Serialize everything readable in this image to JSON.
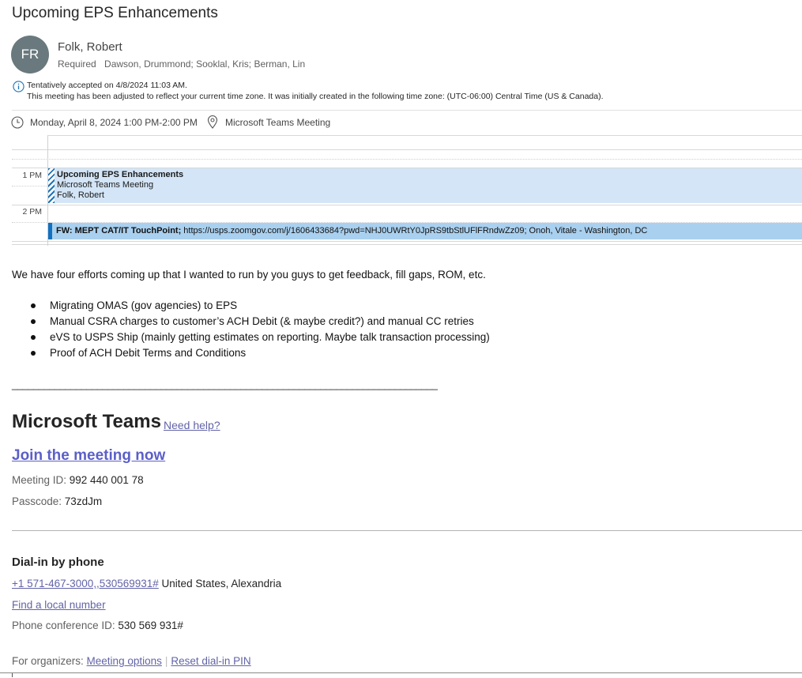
{
  "subject": "Upcoming EPS Enhancements",
  "organizer": {
    "initials": "FR",
    "name": "Folk, Robert",
    "avatar_color": "#69797e"
  },
  "attendees": {
    "label": "Required",
    "names": "Dawson, Drummond; Sooklal, Kris; Berman, Lin"
  },
  "info": {
    "line1": "Tentatively accepted on 4/8/2024 11:03 AM.",
    "line2": "This meeting has been adjusted to reflect your current time zone. It was initially created in the following time zone: (UTC-06:00) Central Time (US & Canada)."
  },
  "when": "Monday, April 8, 2024 1:00 PM-2:00 PM",
  "where": "Microsoft Teams Meeting",
  "calendar": {
    "hours": [
      "1 PM",
      "2 PM"
    ],
    "event1": {
      "title": "Upcoming EPS Enhancements",
      "location": "Microsoft Teams Meeting",
      "organizer": "Folk, Robert",
      "color": "#d3e5f6"
    },
    "event2": {
      "title": "FW: MEPT CAT/IT TouchPoint;",
      "details": " https://usps.zoomgov.com/j/1606433684?pwd=NHJ0UWRtY0JpRS9tbStlUFlFRndwZz09; Onoh, Vitale - Washington, DC",
      "color": "#a9d0ef"
    }
  },
  "message": {
    "intro": "We have four efforts coming up that I wanted to run by you guys to get feedback, fill gaps, ROM, etc.",
    "bullets": [
      "Migrating OMAS (gov agencies) to EPS",
      "Manual CSRA charges to customer’s ACH Debit (& maybe credit?) and manual CC retries",
      "eVS to USPS Ship (mainly getting estimates on reporting. Maybe talk transaction processing)",
      "Proof of ACH Debit Terms and Conditions"
    ],
    "divider": "________________________________________________________________________________"
  },
  "teams": {
    "title": "Microsoft Teams",
    "need_help": "Need help?",
    "join": "Join the meeting now",
    "meeting_id_label": "Meeting ID: ",
    "meeting_id": "992 440 001 78",
    "passcode_label": "Passcode: ",
    "passcode": "73zdJm",
    "accent": "#6264a7"
  },
  "dial": {
    "title": "Dial-in by phone",
    "number": "+1 571-467-3000,,530569931#",
    "region": " United States, Alexandria",
    "find_local": "Find a local number",
    "conf_label": "Phone conference ID: ",
    "conf_id": "530 569 931#"
  },
  "organizers": {
    "label": "For organizers: ",
    "options": "Meeting options",
    "reset": "Reset dial-in PIN"
  }
}
